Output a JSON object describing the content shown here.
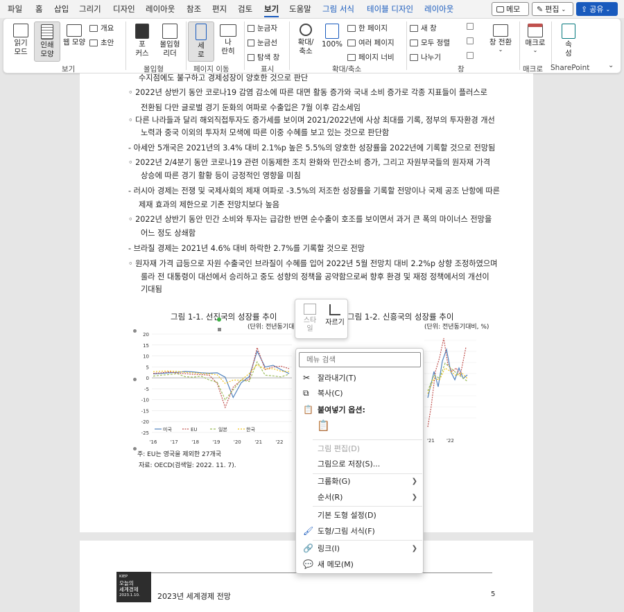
{
  "tabs": [
    "파일",
    "홈",
    "삽입",
    "그리기",
    "디자인",
    "레이아웃",
    "참조",
    "편지",
    "검토",
    "보기",
    "도움말",
    "그림 서식",
    "테이블 디자인",
    "레이아웃"
  ],
  "top_buttons": {
    "memo": "메모",
    "edit": "편집",
    "share": "공유"
  },
  "ribbon": {
    "read_mode": "읽기\n모드",
    "print_layout": "인쇄\n모양",
    "web_layout": "웹 모양",
    "outline": "개요",
    "draft": "초안",
    "focus": "포\n커스",
    "immersive": "몰입형\n리더",
    "vertical": "세\n로",
    "side": "나\n란히",
    "ruler": "눈금자",
    "gridlines": "눈금선",
    "navpane": "탐색 창",
    "zoom": "확대/\n축소",
    "zoom100": "100%",
    "one_page": "한 페이지",
    "multi_page": "여러 페이지",
    "page_width": "페이지 너비",
    "new_window": "새 창",
    "arrange_all": "모두 정렬",
    "split": "나누기",
    "switch_window": "창 전환",
    "macros": "매크로",
    "properties": "속\n성",
    "groups": {
      "view": "보기",
      "immersive": "몰입형",
      "page_move": "페이지 이동",
      "show": "표시",
      "zoom": "확대/축소",
      "window": "창",
      "macro": "매크로",
      "sharepoint": "SharePoint"
    }
  },
  "doc": {
    "lines": [
      "수지점에도 불구하고 경제성장이 양호한 것으로 판단",
      "◦ 2022년 상반기 동안 코로나19 감염 감소에 따른 대면 활동 증가와 국내 소비 증가로 각종 지표들이 플러스로",
      "전환됨 다만 글로벌 경기 둔화의 여파로 수출입은 7월 이후 감소세임",
      "◦ 다른 나라들과 달리 해외직접투자도 증가세를 보이며 2021/2022년에 사상 최대를 기록, 정부의 투자환경 개선",
      "노력과 중국 이외의 투자처 모색에 따른 이중 수혜를 보고 있는 것으로 판단함",
      "- 아세안 5개국은 2021년의 3.4% 대비 2.1%p 높은 5.5%의 양호한 성장률을 2022년에 기록할 것으로 전망됨",
      "◦ 2022년 2/4분기 동안 코로나19 관련 이동제한 조치 완화와 민간소비 증가, 그리고 자원부국들의 원자재 가격",
      "상승에 따른 경기 활황 등이 긍정적인 영향을 미침",
      "- 러시아 경제는 전쟁 및 국제사회의 제재 여파로 -3.5%의 저조한 성장률을 기록할 전망이나 국제 공조 난항에 따른",
      "제재 효과의 제한으로 기존 전망치보다 높음",
      "◦ 2022년 상반기 동안 민간 소비와 투자는 급감한 반면 순수출이 호조를 보이면서 과거 큰 폭의 마이너스 전망을",
      "어느 정도 상쇄함",
      "- 브라질 경제는 2021년 4.6% 대비 하락한 2.7%를 기록할 것으로 전망",
      "◦ 원자재 가격 급등으로 자원 수출국인 브라질이 수혜를 입어 2022년 5월 전망치 대비 2.2%p 상향 조정하였으며",
      "룰라 전 대통령이 대선에서 승리하고 중도 성향의 정책을 공약함으로써 향후 환경 및 재정 정책에서의 개선이",
      "기대됨"
    ],
    "fig1_caption": "그림 1-1. 선진국의 성장률 추이",
    "fig1_unit": "(단위: 전년동기대비, %)",
    "fig2_caption": "그림 1-2. 신흥국의 성장률 추이",
    "fig2_unit": "(단위: 전년동기대비, %)",
    "note1": "주: EU는 영국을 제외한 27개국",
    "note2": "자료: OECD(검색일: 2022. 11. 7).",
    "footer_title": "2023년 세계경제 전망",
    "footer_page": "5",
    "logo_lines": [
      "KIEP",
      "오늘의",
      "세계경제",
      "2023.1.10."
    ]
  },
  "chart_data": {
    "type": "line",
    "title": "그림 1-1. 선진국의 성장률 추이",
    "ylabel": "",
    "ylim": [
      -25,
      20
    ],
    "yticks": [
      20,
      15,
      10,
      5,
      0,
      -5,
      -10,
      -15,
      -20,
      -25
    ],
    "x_ticks": [
      "'16",
      "'17",
      "'18",
      "'19",
      "'20",
      "'21",
      "'22"
    ],
    "series": [
      {
        "name": "미국",
        "color": "#4f81bd",
        "values": [
          1.8,
          2.0,
          2.3,
          2.5,
          2.9,
          2.7,
          2.3,
          2.1,
          2.3,
          0.3,
          -9.0,
          -2.3,
          0.5,
          12.2,
          4.9,
          5.7,
          3.7,
          1.9
        ]
      },
      {
        "name": "EU",
        "color": "#c0504d",
        "values": [
          2.0,
          2.3,
          2.7,
          2.2,
          1.9,
          1.6,
          1.5,
          1.2,
          -2.5,
          -13.5,
          -4.3,
          -1.0,
          -1.0,
          13.8,
          3.8,
          5.0,
          5.3,
          4.2
        ]
      },
      {
        "name": "일본",
        "color": "#9bbb59",
        "values": [
          0.8,
          1.2,
          1.5,
          1.9,
          0.5,
          0.3,
          0.8,
          -1.0,
          -2.0,
          -10.0,
          -5.5,
          -0.9,
          -1.7,
          7.3,
          1.2,
          0.9,
          0.4,
          1.7
        ]
      },
      {
        "name": "한국",
        "color": "#f0c419",
        "values": [
          2.8,
          3.0,
          3.1,
          2.9,
          2.5,
          2.3,
          2.0,
          1.8,
          1.4,
          -2.6,
          -1.0,
          -1.1,
          1.9,
          6.0,
          4.0,
          4.2,
          3.0,
          2.9
        ]
      }
    ],
    "legend": "bottom-left"
  },
  "context_menu": {
    "search_placeholder": "메뉴 검색",
    "cut": "잘라내기(T)",
    "copy": "복사(C)",
    "paste_options": "붙여넣기 옵션:",
    "edit_picture": "그림 편집(D)",
    "save_as_picture": "그림으로 저장(S)...",
    "group": "그룹화(G)",
    "order": "순서(R)",
    "default_shape": "기본 도형 설정(D)",
    "format_shape": "도형/그림 서식(F)",
    "link": "링크(I)",
    "new_comment": "새 메모(M)"
  },
  "pic_toolbar": {
    "style": "스타\n일",
    "crop": "자르기"
  }
}
